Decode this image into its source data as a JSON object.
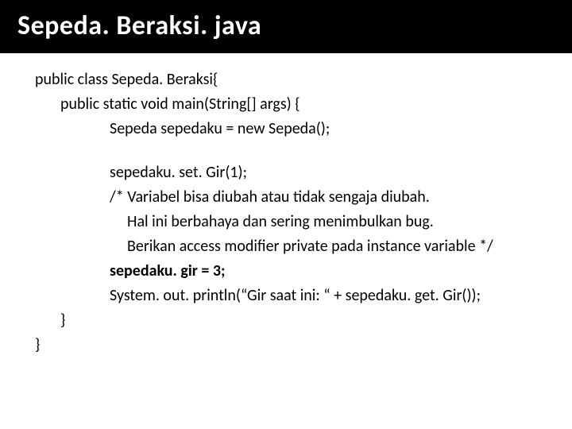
{
  "title": "Sepeda. Beraksi. java",
  "code": {
    "l1": "public class Sepeda. Beraksi{",
    "l2": "public static void main(String[] args) {",
    "l3": "Sepeda sepedaku = new Sepeda();",
    "l4": "sepedaku. set. Gir(1);",
    "l5": "/* Variabel bisa diubah atau tidak sengaja diubah.",
    "l6": "Hal ini berbahaya dan sering menimbulkan bug.",
    "l7": "Berikan access modifier private pada instance variable */",
    "l8": "sepedaku. gir = 3;",
    "l9": "System. out. println(“Gir saat ini: “ + sepedaku. get. Gir());",
    "l10": "}",
    "l11": "}"
  }
}
